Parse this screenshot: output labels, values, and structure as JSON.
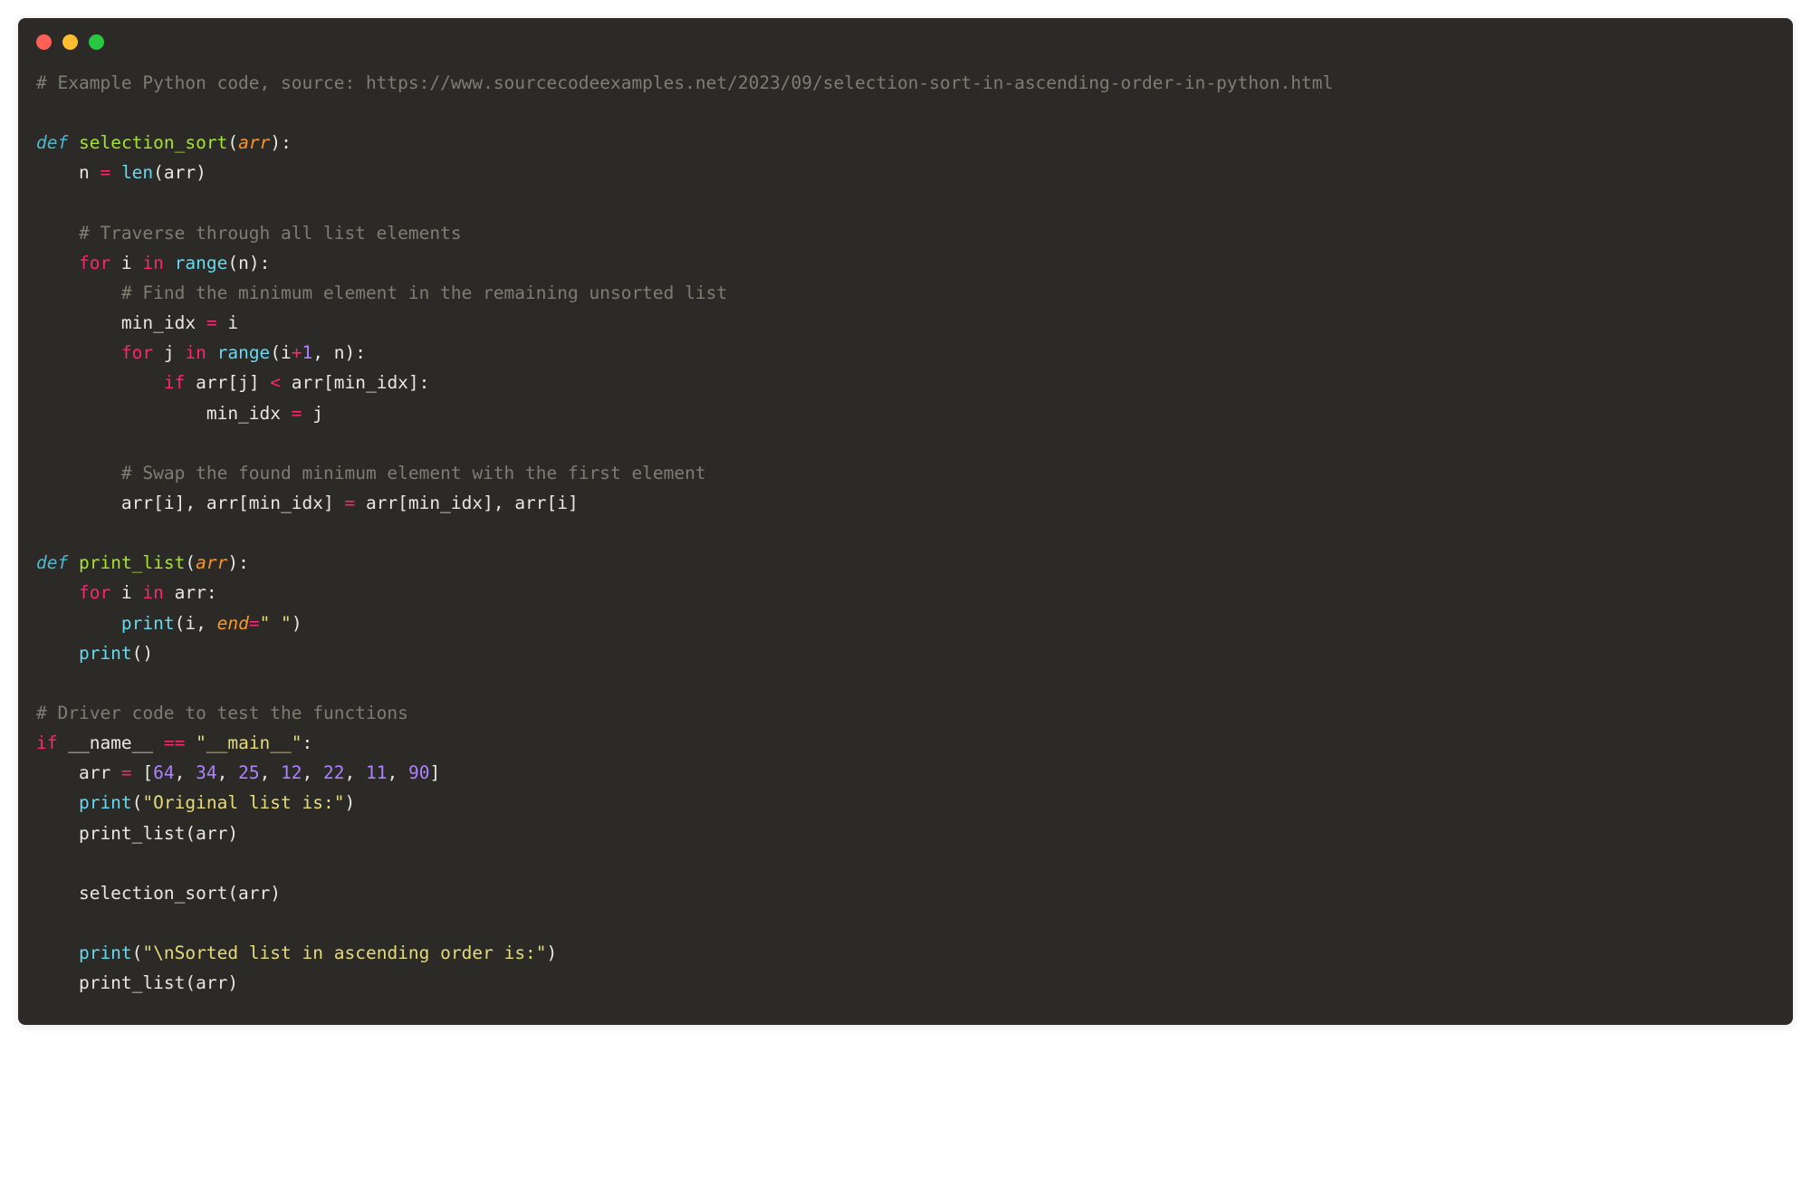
{
  "code": {
    "line1_comment": "# Example Python code, source: https://www.sourcecodeexamples.net/2023/09/selection-sort-in-ascending-order-in-python.html",
    "def1": "def",
    "func1_name": "selection_sort",
    "func1_param": "arr",
    "line_n": "    n ",
    "eq": "=",
    "len_call": " len",
    "len_arg": "(arr)",
    "comment_traverse": "    # Traverse through all list elements",
    "for1": "    for",
    "i_var": " i ",
    "in1": "in",
    "range1": " range",
    "range1_arg": "(n):",
    "comment_findmin": "        # Find the minimum element in the remaining unsorted list",
    "minidx_line": "        min_idx ",
    "minidx_val": " i",
    "for2": "        for",
    "j_var": " j ",
    "in2": "in",
    "range2": " range",
    "range2_open": "(i",
    "plus": "+",
    "one": "1",
    "range2_close": ", n):",
    "if_kw": "            if",
    "if_cond1": " arr[j] ",
    "lt": "<",
    "if_cond2": " arr[min_idx]:",
    "minidx_j": "                min_idx ",
    "minidx_j_val": " j",
    "comment_swap": "        # Swap the found minimum element with the first element",
    "swap_left": "        arr[i], arr[min_idx] ",
    "swap_right": " arr[min_idx], arr[i]",
    "def2": "def",
    "func2_name": "print_list",
    "func2_param": "arr",
    "for3": "    for",
    "i_var2": " i ",
    "in3": "in",
    "arr_colon": " arr:",
    "print1": "        print",
    "print1_open": "(i, ",
    "end_param": "end",
    "print1_eq": "=",
    "space_str": "\" \"",
    "print1_close": ")",
    "print2": "    print",
    "print2_call": "()",
    "comment_driver": "# Driver code to test the functions",
    "if_main": "if",
    "name_var": " __name__ ",
    "eqeq": "==",
    "main_str": " \"__main__\"",
    "main_colon": ":",
    "arr_assign": "    arr ",
    "bracket_open": " [",
    "n64": "64",
    "n34": "34",
    "n25": "25",
    "n12": "12",
    "n22": "22",
    "n11": "11",
    "n90": "90",
    "comma": ", ",
    "bracket_close": "]",
    "print3": "    print",
    "print3_open": "(",
    "orig_str": "\"Original list is:\"",
    "print3_close": ")",
    "printlist1": "    print_list(arr)",
    "selsort_call": "    selection_sort(arr)",
    "print4": "    print",
    "print4_open": "(",
    "sorted_str": "\"\\nSorted list in ascending order is:\"",
    "print4_close": ")",
    "printlist2": "    print_list(arr)"
  }
}
